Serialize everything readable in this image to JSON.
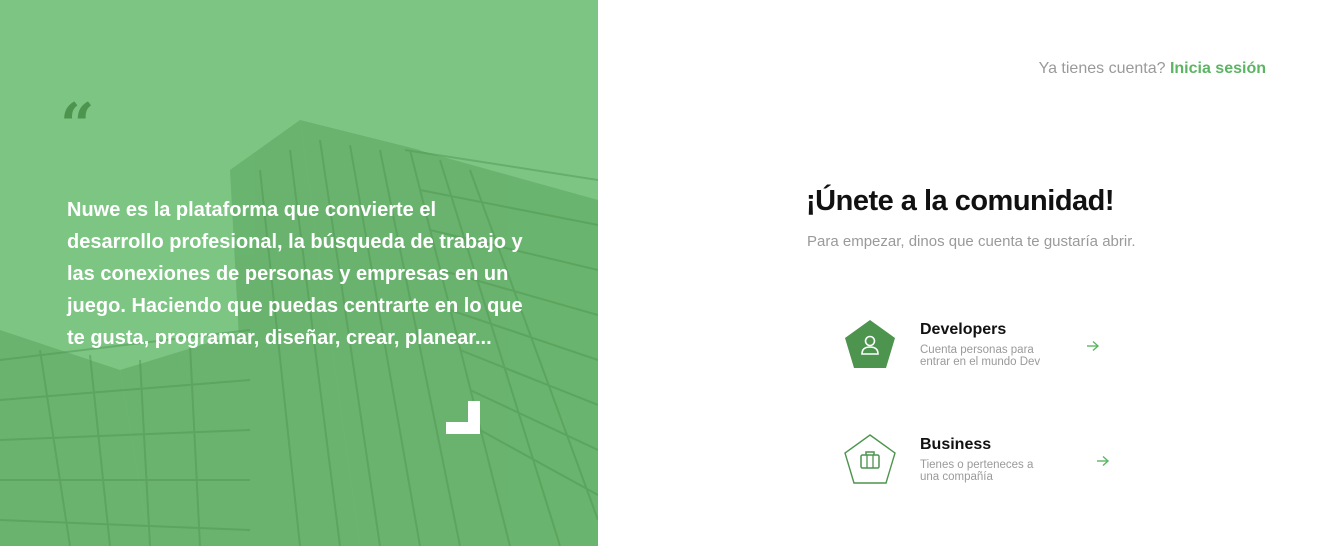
{
  "quote": {
    "mark": "“",
    "text": "Nuwe es la plataforma que convierte el desarrollo profesional, la búsqueda de trabajo y las conexiones de personas y empresas en un juego. Haciendo que puedas centrarte en lo que te gusta, programar, diseñar, crear, planear..."
  },
  "header": {
    "login_prompt": "Ya tienes cuenta?",
    "login_link": "Inicia sesión"
  },
  "main": {
    "title": "¡Únete a la comunidad!",
    "subtitle": "Para empezar, dinos que cuenta te gustaría abrir."
  },
  "options": [
    {
      "title": "Developers",
      "description": "Cuenta personas para entrar en el mundo Dev",
      "icon": "user-icon"
    },
    {
      "title": "Business",
      "description": "Tienes o perteneces a una compañía",
      "icon": "briefcase-icon"
    }
  ],
  "colors": {
    "brand_green": "#5cb563",
    "panel_green": "#7cc583",
    "dark_green": "#4d944f"
  }
}
